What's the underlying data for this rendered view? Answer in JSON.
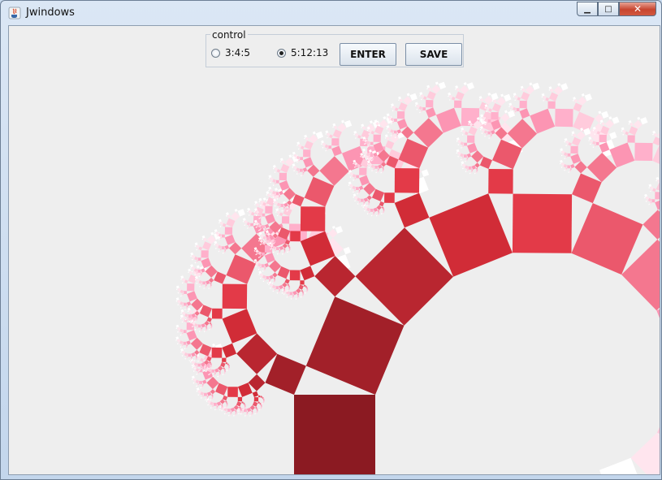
{
  "window": {
    "title": "Jwindows"
  },
  "control": {
    "legend": "control",
    "options": [
      {
        "label": "3:4:5",
        "selected": false
      },
      {
        "label": "5:12:13",
        "selected": true
      }
    ],
    "enter_label": "ENTER",
    "save_label": "SAVE"
  },
  "fractal": {
    "type": "pythagoras-tree",
    "ratio": [
      5,
      12,
      13
    ],
    "colors": {
      "trunk": "#8b1a22",
      "mid": "#e0303c",
      "tip": "#ff9fbf",
      "leaf": "#ffffff"
    }
  }
}
